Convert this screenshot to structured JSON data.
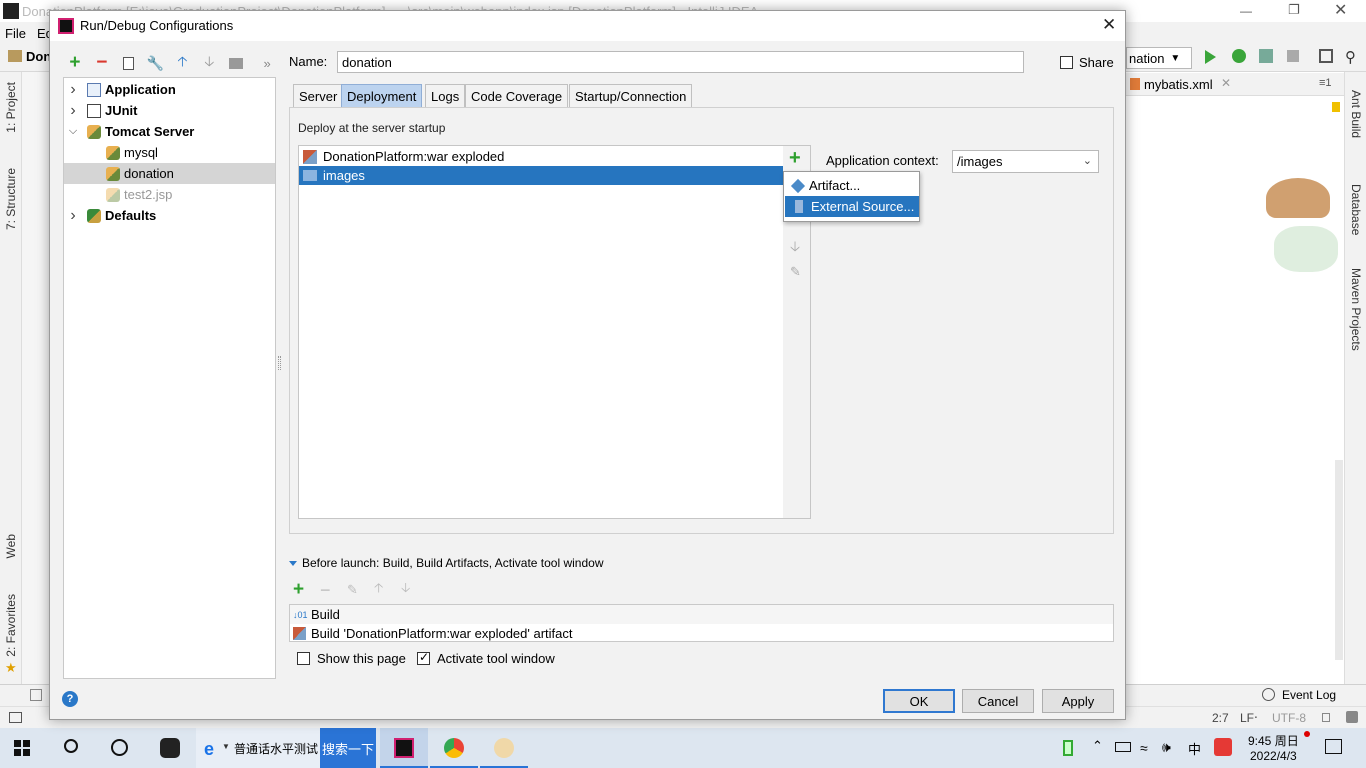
{
  "ide": {
    "window_title": "DonationPlatform [E:\\java\\GraduationProject\\DonationPlatform] - ...\\src\\main\\webapp\\index.jsp [DonationPlatform] - IntelliJ IDEA",
    "menu": [
      "File",
      "Ed"
    ],
    "toolbar_project": "Don",
    "run_config_combo": "nation",
    "editor_tab": "mybatis.xml",
    "left_tools": [
      "1: Project",
      "7: Structure",
      "Web",
      "2: Favorites"
    ],
    "right_tools": [
      "Ant Build",
      "Database",
      "Maven Projects"
    ],
    "event_log": "Event Log",
    "status": {
      "position": "2:7",
      "line_sep": "LF‧",
      "encoding": "UTF-8"
    }
  },
  "dialog": {
    "title": "Run/Debug Configurations",
    "name_label": "Name:",
    "name_value": "donation",
    "share_label": "Share",
    "share_checked": false,
    "tree": [
      {
        "label": "Application",
        "level": 0,
        "expanded": false,
        "bold": true,
        "icon": "application-icon"
      },
      {
        "label": "JUnit",
        "level": 0,
        "expanded": false,
        "bold": true,
        "icon": "junit-icon"
      },
      {
        "label": "Tomcat Server",
        "level": 0,
        "expanded": true,
        "bold": true,
        "icon": "tomcat-icon"
      },
      {
        "label": "mysql",
        "level": 1,
        "bold": false,
        "icon": "tomcat-icon"
      },
      {
        "label": "donation",
        "level": 1,
        "bold": false,
        "selected": true,
        "icon": "tomcat-icon"
      },
      {
        "label": "test2.jsp",
        "level": 1,
        "bold": false,
        "disabled": true,
        "icon": "tomcat-icon"
      },
      {
        "label": "Defaults",
        "level": 0,
        "expanded": false,
        "bold": true,
        "icon": "wrench-icon"
      }
    ],
    "tabs": [
      "Server",
      "Deployment",
      "Logs",
      "Code Coverage",
      "Startup/Connection"
    ],
    "active_tab": "Deployment",
    "deploy_group_label": "Deploy at the server startup",
    "deploy_items": [
      "DonationPlatform:war exploded",
      "images"
    ],
    "deploy_selected": "images",
    "popup_items": [
      "Artifact...",
      "External Source..."
    ],
    "popup_selected": "External Source...",
    "app_context_label": "Application context:",
    "app_context_value": "/images",
    "before_launch_label": "Before launch: Build, Build Artifacts, Activate tool window",
    "before_launch_items": [
      "Build",
      "Build 'DonationPlatform:war exploded' artifact"
    ],
    "show_page_label": "Show this page",
    "show_page_checked": false,
    "activate_tool_label": "Activate tool window",
    "activate_tool_checked": true,
    "buttons": {
      "ok": "OK",
      "cancel": "Cancel",
      "apply": "Apply"
    },
    "help": "?"
  },
  "taskbar": {
    "search_text": "普通话水平测试",
    "search_button": "搜索一下",
    "clock_time": "9:45 周日",
    "clock_date": "2022/4/3",
    "ime": "中"
  },
  "colors": {
    "selection": "#2675bf",
    "accent_green": "#2ea02e",
    "tab_active": "#bcd3ef"
  }
}
